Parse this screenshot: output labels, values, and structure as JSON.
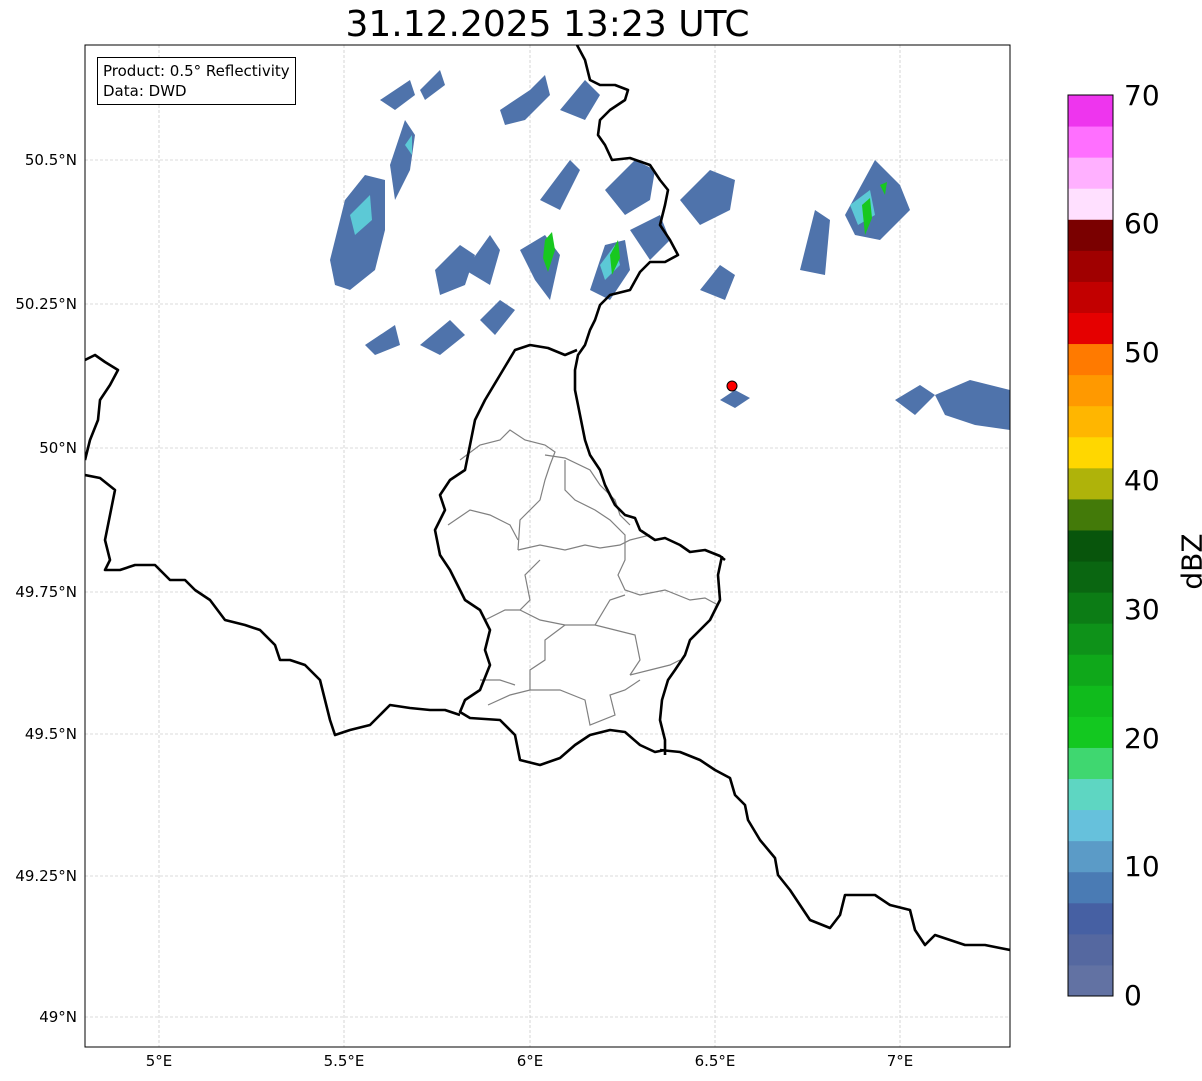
{
  "title": "31.12.2025 13:23 UTC",
  "info": {
    "product": "Product: 0.5° Reflectivity",
    "source": "Data: DWD"
  },
  "lat_labels": [
    "50.5°N",
    "50.25°N",
    "50°N",
    "49.75°N",
    "49.5°N",
    "49.25°N",
    "49°N"
  ],
  "lon_labels": [
    "5°E",
    "5.5°E",
    "6°E",
    "6.5°E",
    "7°E"
  ],
  "colorbar": {
    "label": "dBZ",
    "ticks": [
      "0",
      "10",
      "20",
      "30",
      "40",
      "50",
      "60",
      "70"
    ],
    "colors": [
      "#6272a3",
      "#5568a0",
      "#4660a3",
      "#4a7bb4",
      "#5b9bc7",
      "#66c1dc",
      "#5ed6c2",
      "#3fd770",
      "#13c820",
      "#10bb1c",
      "#0fa81a",
      "#0e9219",
      "#0c7c15",
      "#0a6611",
      "#08550c",
      "#437a09",
      "#afb30a",
      "#ffd700",
      "#ffb600",
      "#ff9900",
      "#ff7a00",
      "#e50000",
      "#c20000",
      "#a00000",
      "#7a0000",
      "#ffe0ff",
      "#ffb0ff",
      "#ff6fff",
      "#ee35ee"
    ]
  },
  "radar_marker_color": "#ff0000"
}
